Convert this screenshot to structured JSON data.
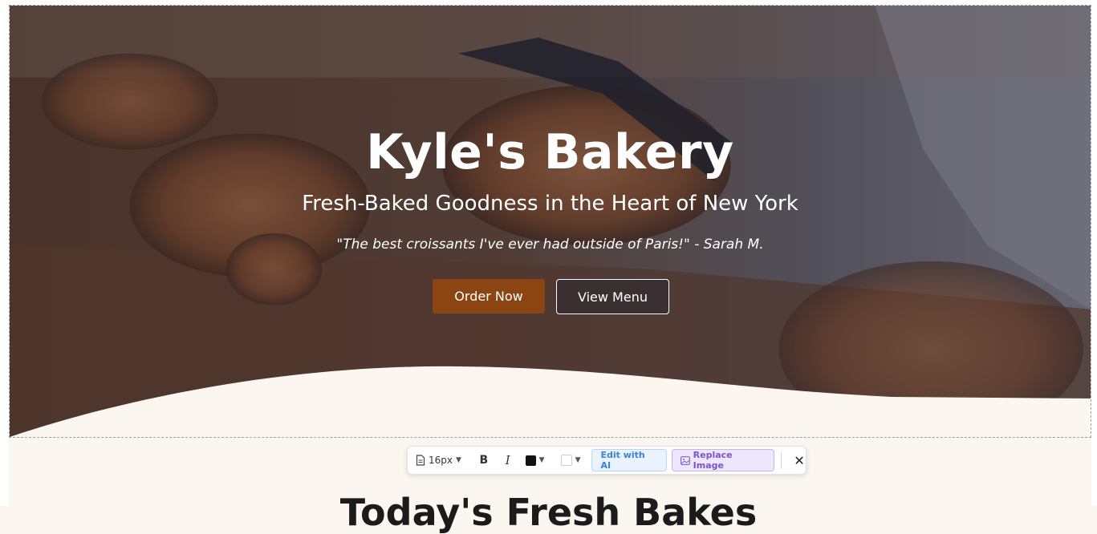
{
  "hero": {
    "title": "Kyle's Bakery",
    "subtitle": "Fresh-Baked Goodness in the Heart of New York",
    "quote": "\"The best croissants I've ever had outside of Paris!\" - Sarah M.",
    "order_button": "Order Now",
    "menu_button": "View Menu"
  },
  "toolbar": {
    "font_size": "16px",
    "bold_label": "B",
    "italic_label": "I",
    "edit_ai_label": "Edit with AI",
    "replace_image_label": "Replace Image",
    "close_label": "✕"
  },
  "next_section": {
    "title": "Today's Fresh Bakes"
  },
  "colors": {
    "accent_brown": "#8b4513",
    "page_background": "#fbf6f0",
    "ai_blue": "#3b82d6",
    "replace_purple": "#7a55c9"
  }
}
